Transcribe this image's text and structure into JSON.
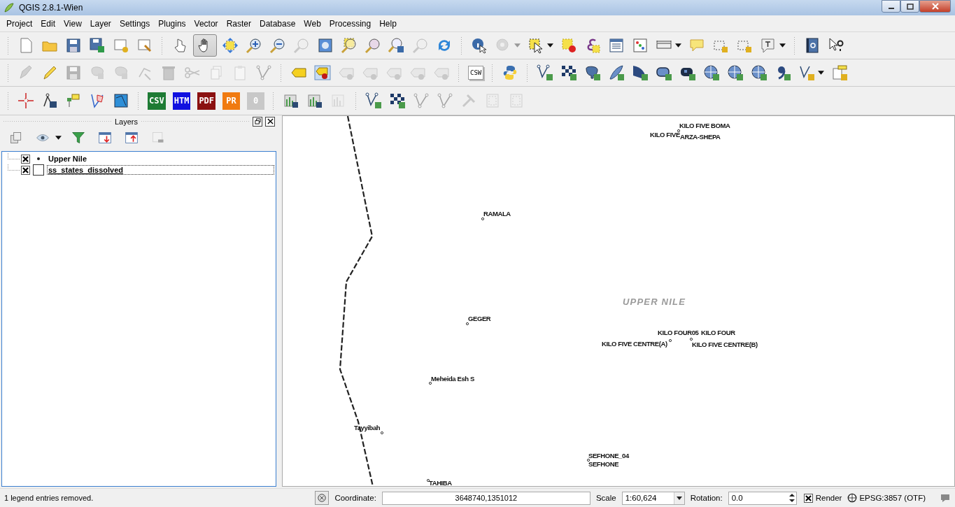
{
  "window": {
    "title": "QGIS 2.8.1-Wien"
  },
  "menu": [
    "Project",
    "Edit",
    "View",
    "Layer",
    "Settings",
    "Plugins",
    "Vector",
    "Raster",
    "Database",
    "Web",
    "Processing",
    "Help"
  ],
  "pan_tool": {
    "selected": true
  },
  "csw_button": "CSW",
  "export_buttons": [
    {
      "label": "CSV",
      "color": "#1e7b34"
    },
    {
      "label": "HTM",
      "color": "#1010e0"
    },
    {
      "label": "PDF",
      "color": "#8b1010"
    },
    {
      "label": "PR",
      "color": "#f07a10"
    },
    {
      "label": "0",
      "color": "#c8c8c8"
    }
  ],
  "layers_panel": {
    "title": "Layers",
    "layers": [
      {
        "name": "Upper Nile",
        "kind": "point",
        "visible": true,
        "selected": false
      },
      {
        "name": "ss_states_dissolved",
        "kind": "polygon",
        "visible": true,
        "selected": true
      }
    ]
  },
  "map": {
    "labels": [
      {
        "text": "KILO FIVE BOMA",
        "kind": "place"
      },
      {
        "text": "KILO FIVE",
        "kind": "place"
      },
      {
        "text": "ARZA-SHEPA",
        "kind": "place"
      },
      {
        "text": "RAMALA",
        "kind": "place"
      },
      {
        "text": "UPPER NILE",
        "kind": "region"
      },
      {
        "text": "GEGER",
        "kind": "place"
      },
      {
        "text": "KILO FOUR05",
        "kind": "place"
      },
      {
        "text": "KILO FOUR",
        "kind": "place"
      },
      {
        "text": "KILO FIVE CENTRE(A)",
        "kind": "place"
      },
      {
        "text": "KILO FIVE CENTRE(B)",
        "kind": "place"
      },
      {
        "text": "Meheida Esh S",
        "kind": "place"
      },
      {
        "text": "Tayyibah",
        "kind": "place"
      },
      {
        "text": "SEFHONE_04",
        "kind": "place"
      },
      {
        "text": "SEFHONE",
        "kind": "place"
      },
      {
        "text": "TAHIBA",
        "kind": "place"
      }
    ]
  },
  "status_bar": {
    "message": "1 legend entries removed.",
    "coordinate_label": "Coordinate:",
    "coordinate": "3648740,1351012",
    "scale_label": "Scale",
    "scale": "1:60,624",
    "rotation_label": "Rotation:",
    "rotation": "0.0",
    "render": {
      "label": "Render",
      "checked": true
    },
    "crs": "EPSG:3857 (OTF)"
  }
}
